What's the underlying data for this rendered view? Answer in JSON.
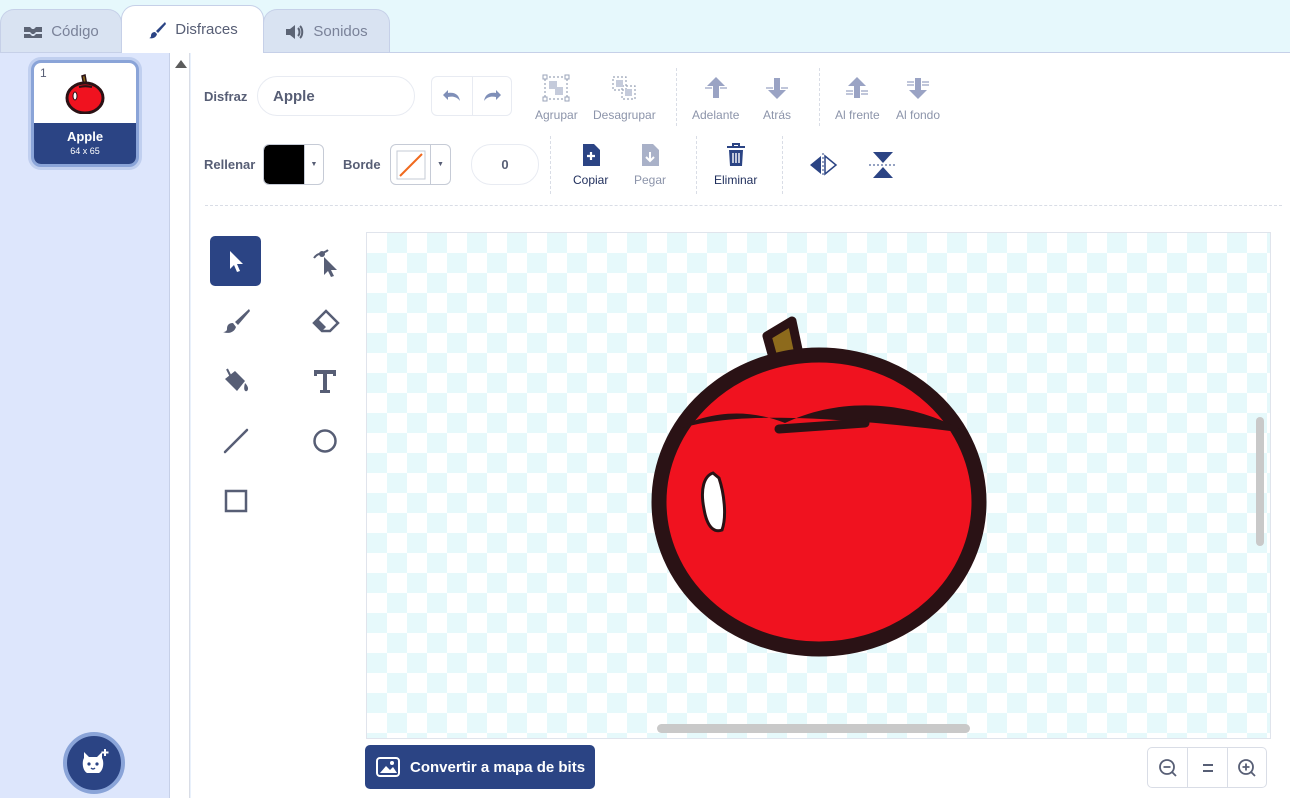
{
  "tabs": [
    {
      "label": "Código",
      "icon": "code-icon"
    },
    {
      "label": "Disfraces",
      "icon": "brush-icon"
    },
    {
      "label": "Sonidos",
      "icon": "speaker-icon"
    }
  ],
  "costumes": [
    {
      "number": "1",
      "name": "Apple",
      "size": "64 x 65"
    }
  ],
  "toolbar": {
    "costume_label": "Disfraz",
    "costume_name": "Apple",
    "group": "Agrupar",
    "ungroup": "Desagrupar",
    "forward": "Adelante",
    "backward": "Atrás",
    "front": "Al frente",
    "back": "Al fondo",
    "fill_label": "Rellenar",
    "fill_color": "#000000",
    "outline_label": "Borde",
    "outline_width": "0",
    "copy": "Copiar",
    "paste": "Pegar",
    "delete": "Eliminar"
  },
  "tools": [
    "select-tool",
    "reshape-tool",
    "brush-tool",
    "eraser-tool",
    "fill-tool",
    "text-tool",
    "line-tool",
    "circle-tool",
    "rectangle-tool"
  ],
  "canvas": {
    "apple_colors": {
      "body": "#f0121f",
      "outline": "#2a1215",
      "stem": "#8d6a1c",
      "highlight": "#ffffff"
    }
  },
  "convert_button": "Convertir a mapa de bits",
  "zoom": {
    "out": "zoom-out-icon",
    "reset": "zoom-reset-icon",
    "in": "zoom-in-icon"
  },
  "colors": {
    "accent": "#2b4484",
    "selection": "#8aa4d8"
  }
}
